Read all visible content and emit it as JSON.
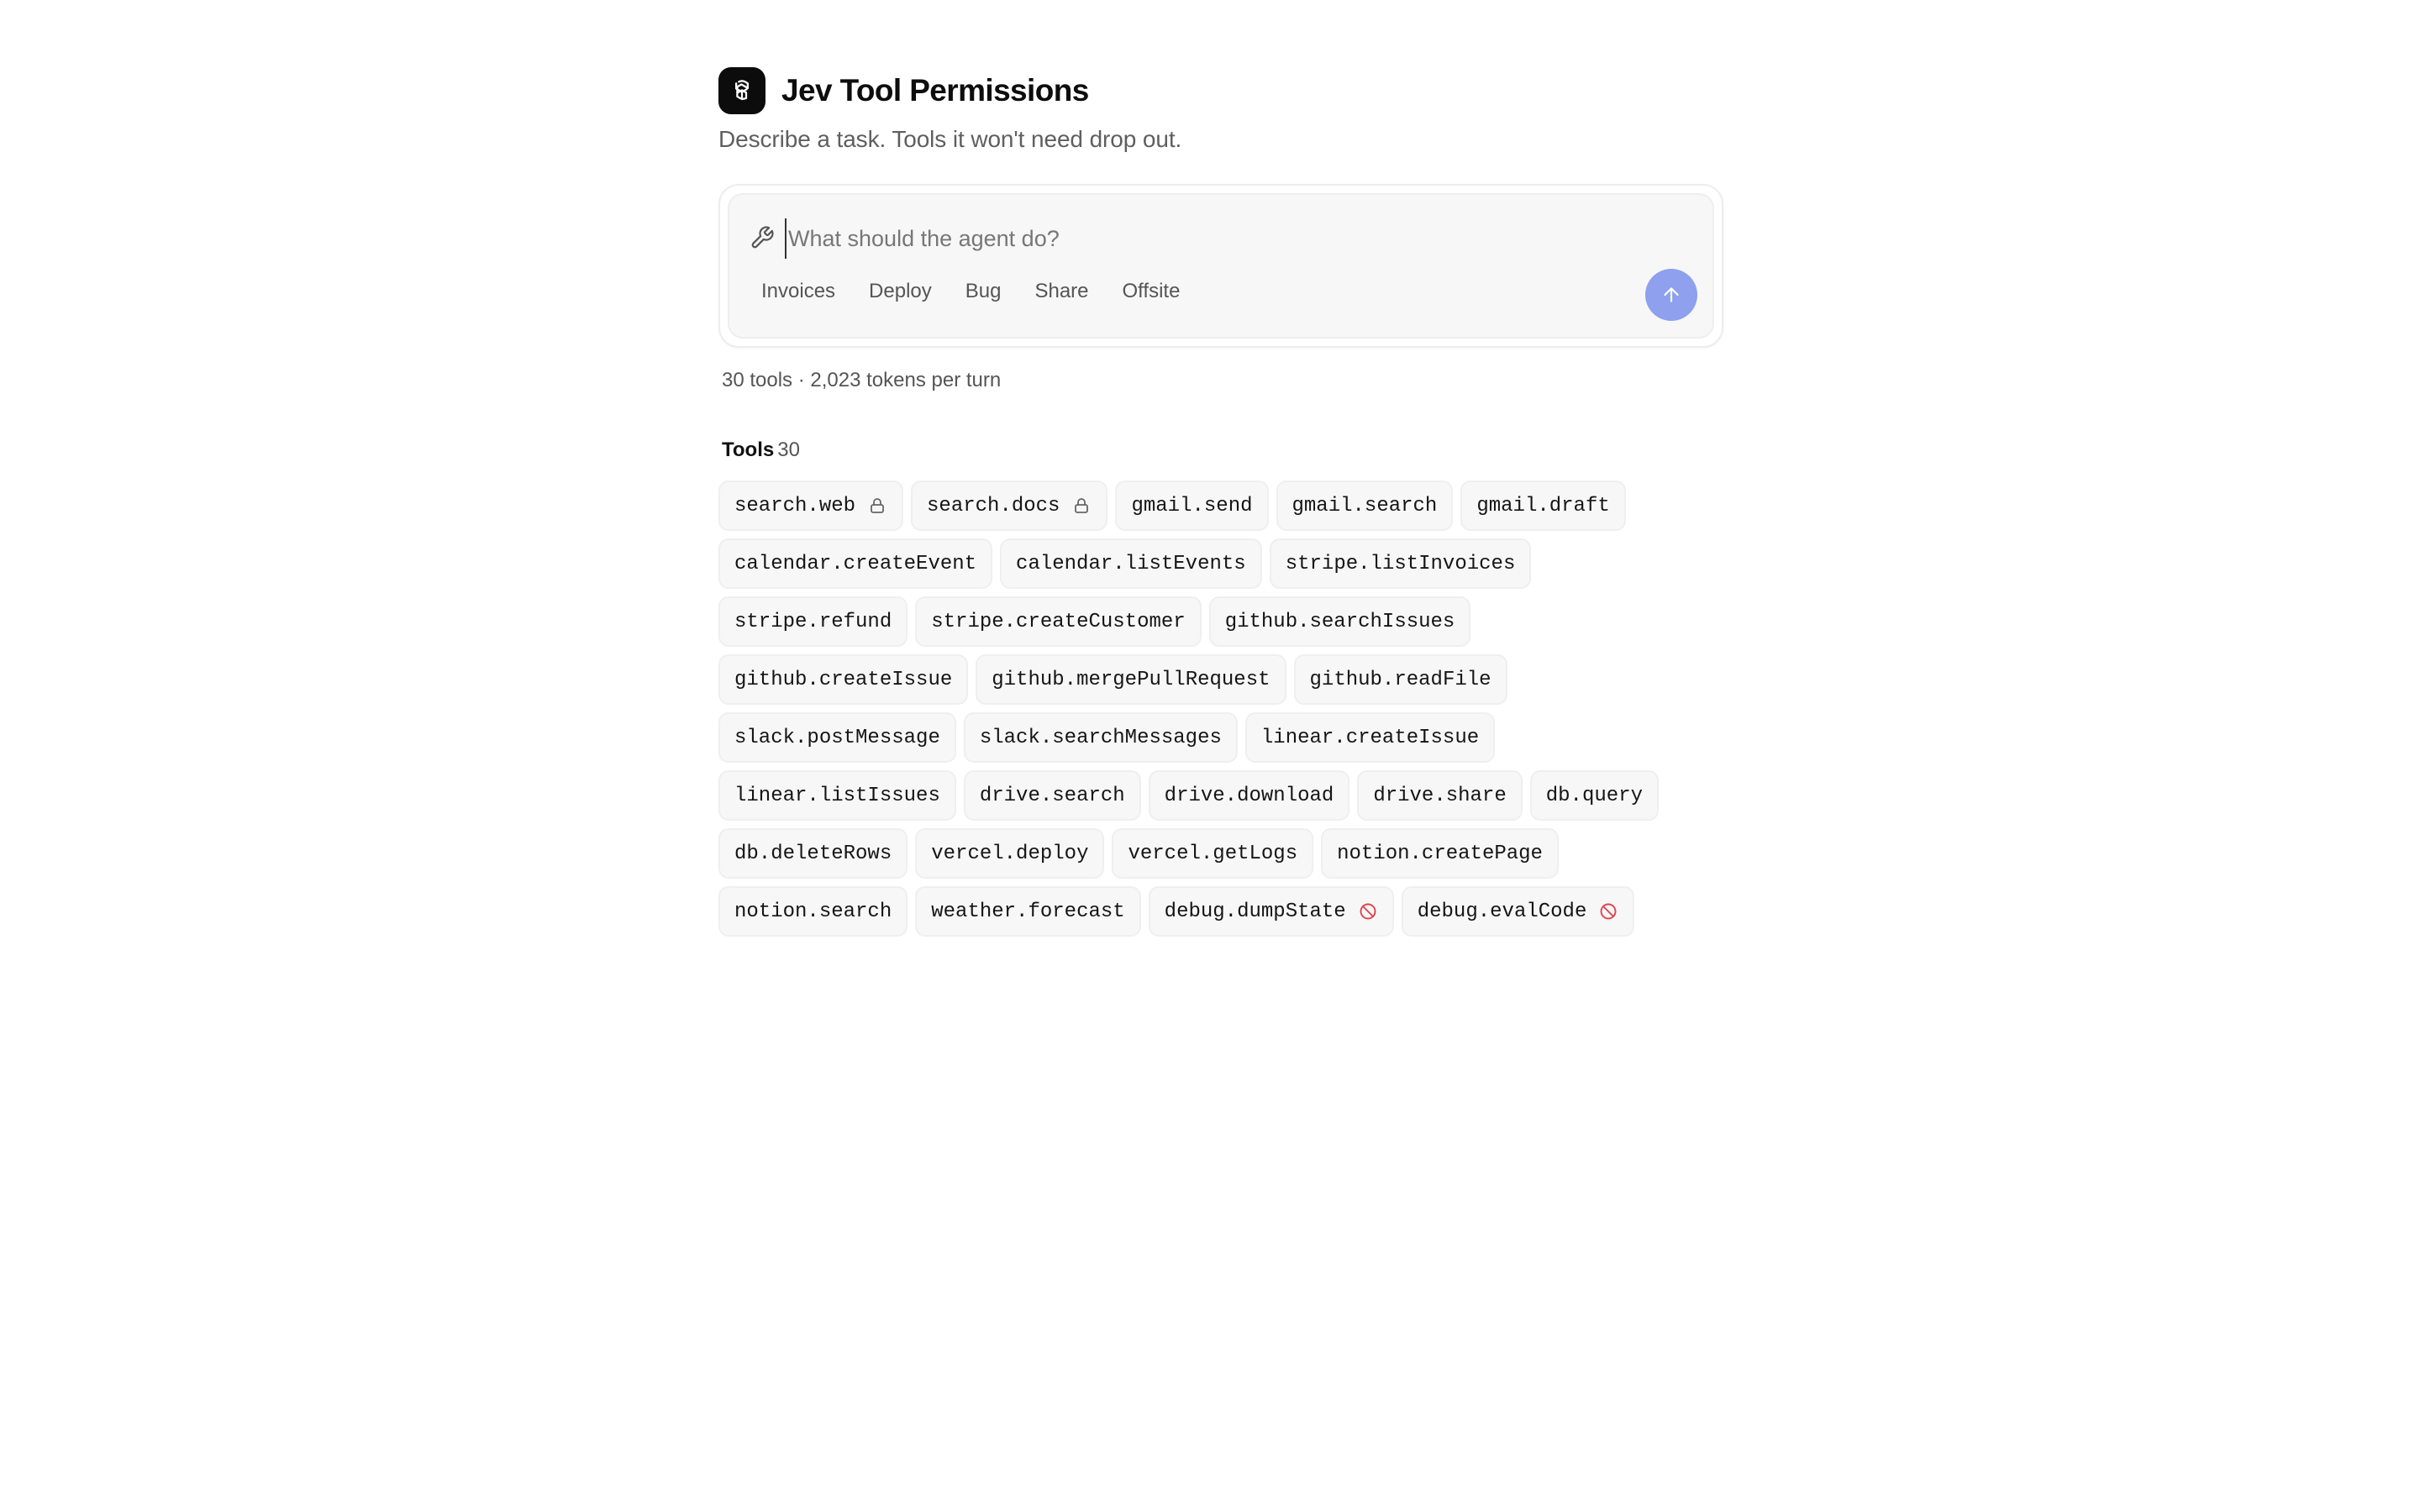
{
  "header": {
    "title": "Jev Tool Permissions",
    "subtitle": "Describe a task. Tools it won't need drop out."
  },
  "composer": {
    "placeholder": "What should the agent do?",
    "value": "",
    "suggestions": [
      "Invoices",
      "Deploy",
      "Bug",
      "Share",
      "Offsite"
    ],
    "send_icon": "arrow-up-icon",
    "accent": "#8ea0ee"
  },
  "summary": "30 tools · 2,023 tokens per turn",
  "tools": {
    "label": "Tools",
    "count": "30",
    "items": [
      {
        "name": "search.web",
        "status": "locked",
        "icon": "lock-icon"
      },
      {
        "name": "search.docs",
        "status": "locked",
        "icon": "lock-icon"
      },
      {
        "name": "gmail.send",
        "status": "available"
      },
      {
        "name": "gmail.search",
        "status": "available"
      },
      {
        "name": "gmail.draft",
        "status": "available"
      },
      {
        "name": "calendar.createEvent",
        "status": "available"
      },
      {
        "name": "calendar.listEvents",
        "status": "available"
      },
      {
        "name": "stripe.listInvoices",
        "status": "available"
      },
      {
        "name": "stripe.refund",
        "status": "available"
      },
      {
        "name": "stripe.createCustomer",
        "status": "available"
      },
      {
        "name": "github.searchIssues",
        "status": "available"
      },
      {
        "name": "github.createIssue",
        "status": "available"
      },
      {
        "name": "github.mergePullRequest",
        "status": "available"
      },
      {
        "name": "github.readFile",
        "status": "available"
      },
      {
        "name": "slack.postMessage",
        "status": "available"
      },
      {
        "name": "slack.searchMessages",
        "status": "available"
      },
      {
        "name": "linear.createIssue",
        "status": "available"
      },
      {
        "name": "linear.listIssues",
        "status": "available"
      },
      {
        "name": "drive.search",
        "status": "available"
      },
      {
        "name": "drive.download",
        "status": "available"
      },
      {
        "name": "drive.share",
        "status": "available"
      },
      {
        "name": "db.query",
        "status": "available"
      },
      {
        "name": "db.deleteRows",
        "status": "available"
      },
      {
        "name": "vercel.deploy",
        "status": "available"
      },
      {
        "name": "vercel.getLogs",
        "status": "available"
      },
      {
        "name": "notion.createPage",
        "status": "available"
      },
      {
        "name": "notion.search",
        "status": "available"
      },
      {
        "name": "weather.forecast",
        "status": "available"
      },
      {
        "name": "debug.dumpState",
        "status": "blocked",
        "icon": "blocked-icon"
      },
      {
        "name": "debug.evalCode",
        "status": "blocked",
        "icon": "blocked-icon"
      }
    ]
  },
  "colors": {
    "blocked": "#e0424f",
    "lock": "#666666"
  }
}
